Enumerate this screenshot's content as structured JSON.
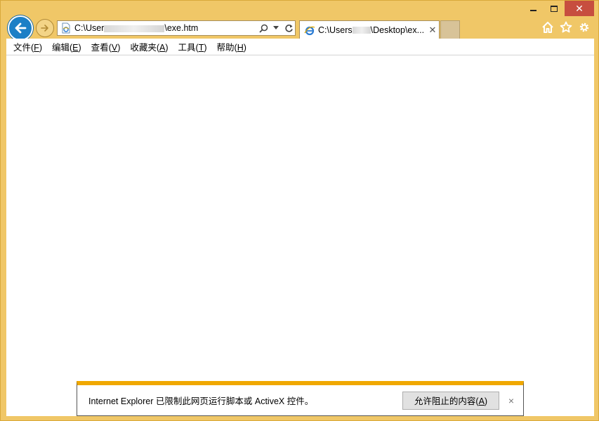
{
  "window": {
    "caption": {
      "minimize_icon": "minimize-icon",
      "maximize_icon": "maximize-icon",
      "close_glyph": "✕"
    }
  },
  "navigation": {
    "back_icon": "back-arrow-icon",
    "forward_icon": "forward-arrow-icon"
  },
  "address_bar": {
    "url_prefix": "C:\\User",
    "url_suffix": "\\exe.htm",
    "search_icon": "search-icon",
    "dropdown_icon": "chevron-down-icon",
    "refresh_icon": "refresh-icon"
  },
  "tab": {
    "title_prefix": "C:\\Users",
    "title_suffix": "\\Desktop\\ex...",
    "close_glyph": "✕"
  },
  "toolbar_icons": [
    "home-icon",
    "star-icon",
    "gear-icon"
  ],
  "menu": [
    {
      "label": "文件(",
      "key": "F",
      "tail": ")"
    },
    {
      "label": "编辑(",
      "key": "E",
      "tail": ")"
    },
    {
      "label": "查看(",
      "key": "V",
      "tail": ")"
    },
    {
      "label": "收藏夹(",
      "key": "A",
      "tail": ")"
    },
    {
      "label": "工具(",
      "key": "T",
      "tail": ")"
    },
    {
      "label": "帮助(",
      "key": "H",
      "tail": ")"
    }
  ],
  "notification": {
    "message": "Internet Explorer 已限制此网页运行脚本或 ActiveX 控件。",
    "button_label": "允许阻止的内容(",
    "button_key": "A",
    "button_tail": ")",
    "close_glyph": "×",
    "accent_color": "#f0a800"
  },
  "colors": {
    "frame": "#f0c767",
    "back_button": "#1b7fc6",
    "close_button": "#c74e3f"
  }
}
